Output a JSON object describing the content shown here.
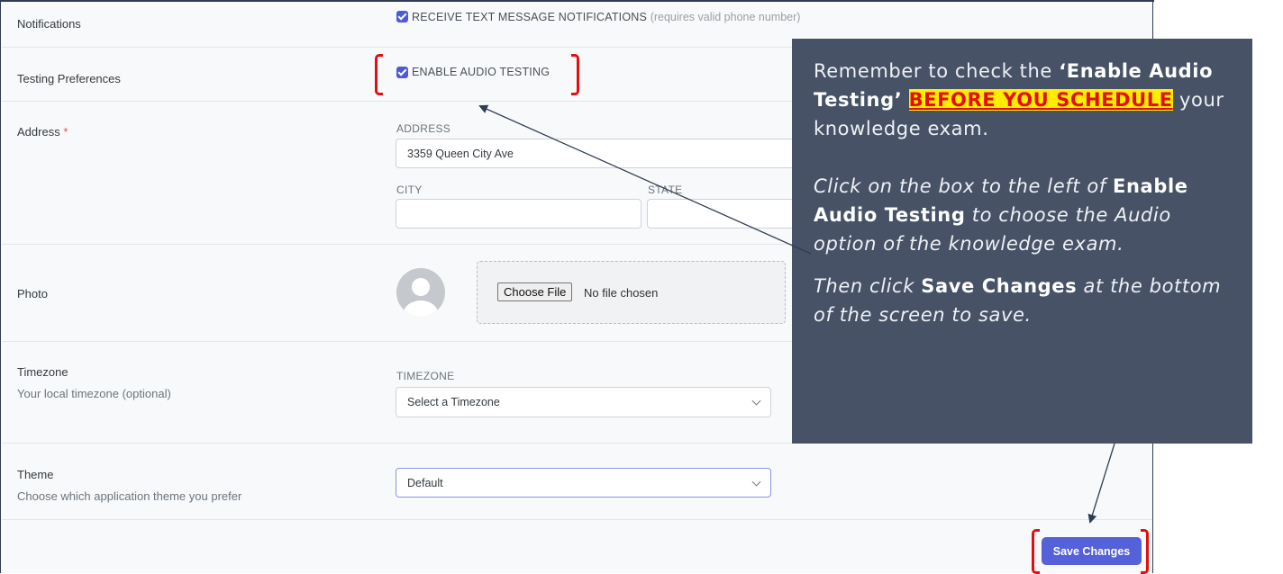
{
  "notifications": {
    "label": "Notifications",
    "checkbox_label": "RECEIVE TEXT MESSAGE NOTIFICATIONS",
    "checkbox_hint": "(requires valid phone number)",
    "checked": true
  },
  "testing_preferences": {
    "label": "Testing Preferences",
    "checkbox_label": "ENABLE AUDIO TESTING",
    "checked": true
  },
  "address": {
    "label": "Address",
    "required_mark": "*",
    "address_label": "ADDRESS",
    "address_value": "3359 Queen City Ave",
    "city_label": "CITY",
    "city_value": "",
    "state_label": "STATE",
    "state_value": ""
  },
  "photo": {
    "label": "Photo",
    "choose_file_label": "Choose File",
    "no_file_text": "No file chosen"
  },
  "timezone": {
    "label": "Timezone",
    "description": "Your local timezone (optional)",
    "field_label": "TIMEZONE",
    "selected": "Select a Timezone"
  },
  "theme": {
    "label": "Theme",
    "description": "Choose which application theme you prefer",
    "selected": "Default"
  },
  "save_button_label": "Save Changes",
  "callout": {
    "p1_a": "Remember to check the ",
    "p1_b": "‘Enable Audio Testing’",
    "p1_hl": "BEFORE YOU SCHEDULE",
    "p1_c": " your knowledge exam.",
    "p2_a": "Click on the box to the left of ",
    "p2_b": "Enable Audio Testing",
    "p2_c": " to choose the Audio option of the knowledge exam.",
    "p3_a": "Then click ",
    "p3_b": "Save Changes",
    "p3_c": " at the bottom of the screen to save."
  },
  "colors": {
    "accent": "#5561d8",
    "callout_bg": "#475266",
    "bracket": "#e01010",
    "highlight": "#ffec00"
  }
}
